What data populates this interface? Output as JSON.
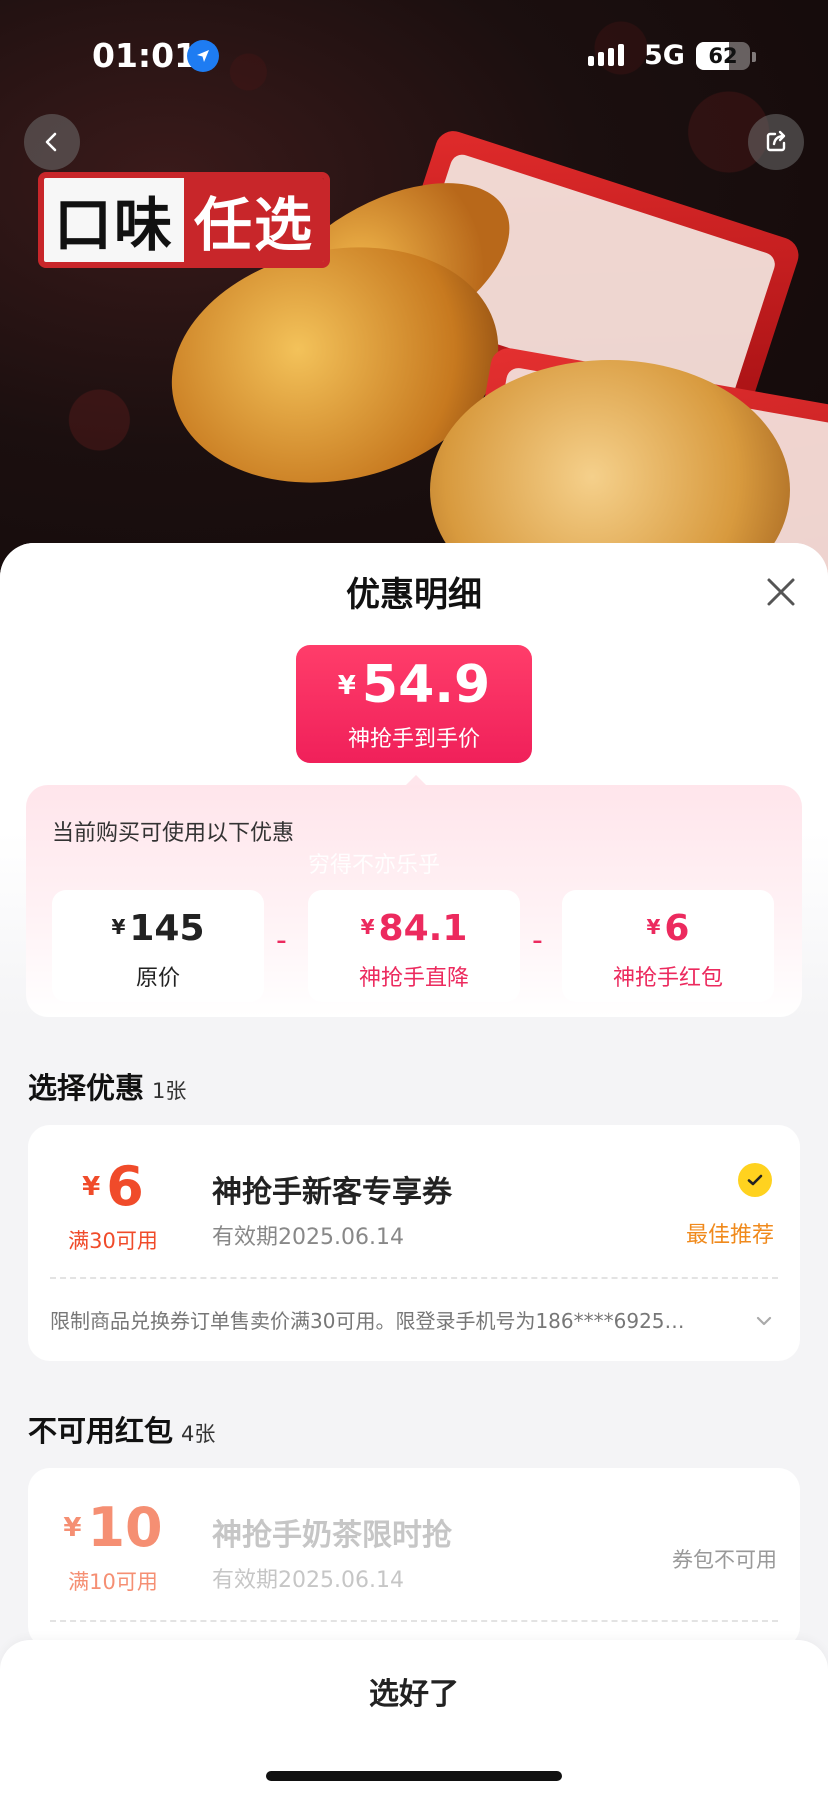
{
  "status_bar": {
    "time": "01:01",
    "network": "5G",
    "battery": "62",
    "battery_level": 0.62
  },
  "hero": {
    "tag_part1": "口味",
    "tag_part2": "任选"
  },
  "sheet": {
    "title": "优惠明细",
    "final_price": {
      "currency": "¥",
      "amount": "54.9",
      "label": "神抢手到手价"
    },
    "breakdown": {
      "heading": "当前购买可使用以下优惠",
      "watermark": "穷得不亦乐乎",
      "operator": "-",
      "items": [
        {
          "currency": "¥",
          "value": "145",
          "label": "原价"
        },
        {
          "currency": "¥",
          "value": "84.1",
          "label": "神抢手直降"
        },
        {
          "currency": "¥",
          "value": "6",
          "label": "神抢手红包"
        }
      ]
    },
    "select_section": {
      "title": "选择优惠",
      "count": "1张",
      "coupon": {
        "currency": "¥",
        "amount": "6",
        "condition": "满30可用",
        "name": "神抢手新客专享券",
        "validity": "有效期2025.06.14",
        "badge": "最佳推荐",
        "description": "限制商品兑换券订单售卖价满30可用。限登录手机号为186****6925…"
      }
    },
    "unavailable_section": {
      "title": "不可用红包",
      "count": "4张",
      "coupon": {
        "currency": "¥",
        "amount": "10",
        "condition": "满10可用",
        "name": "神抢手奶茶限时抢",
        "validity": "有效期2025.06.14",
        "status": "券包不可用"
      }
    },
    "done_button": "选好了"
  },
  "colors": {
    "accent_pink": "#f0205a",
    "coupon_orange": "#f04b2a",
    "best_orange": "#f08a1c",
    "check_yellow": "#ffd21f"
  }
}
